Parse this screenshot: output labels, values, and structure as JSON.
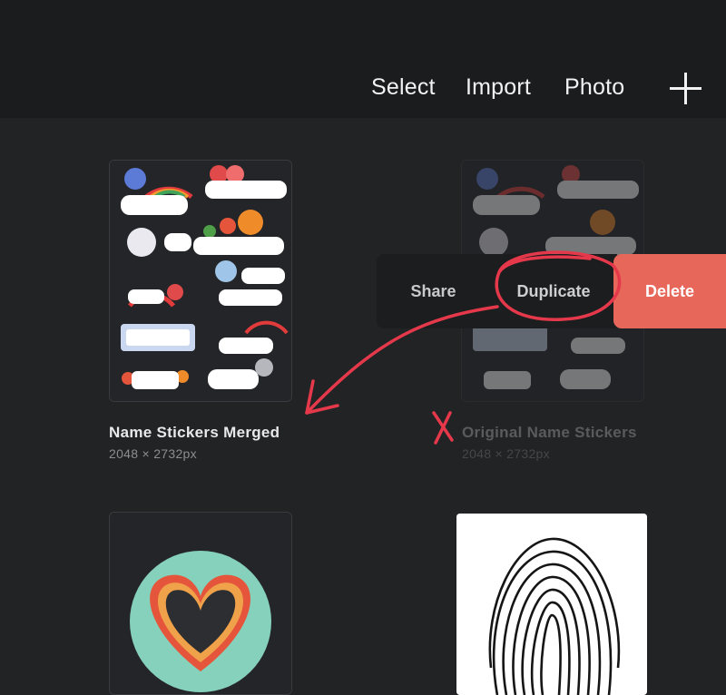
{
  "toolbar": {
    "select_label": "Select",
    "import_label": "Import",
    "photo_label": "Photo",
    "add_icon": "plus-icon"
  },
  "artworks": [
    {
      "title": "Name Stickers Merged",
      "size": "2048 × 2732px"
    },
    {
      "title": "Original Name Stickers",
      "size": "2048 × 2732px"
    },
    {
      "title": "",
      "size": ""
    },
    {
      "title": "",
      "size": ""
    }
  ],
  "context_menu": {
    "share_label": "Share",
    "duplicate_label": "Duplicate",
    "delete_label": "Delete"
  },
  "colors": {
    "background": "#222325",
    "toolbar": "#1b1c1e",
    "delete": "#e7685a",
    "annotation": "#e5394b",
    "heart_circle": "#86d1bb"
  }
}
